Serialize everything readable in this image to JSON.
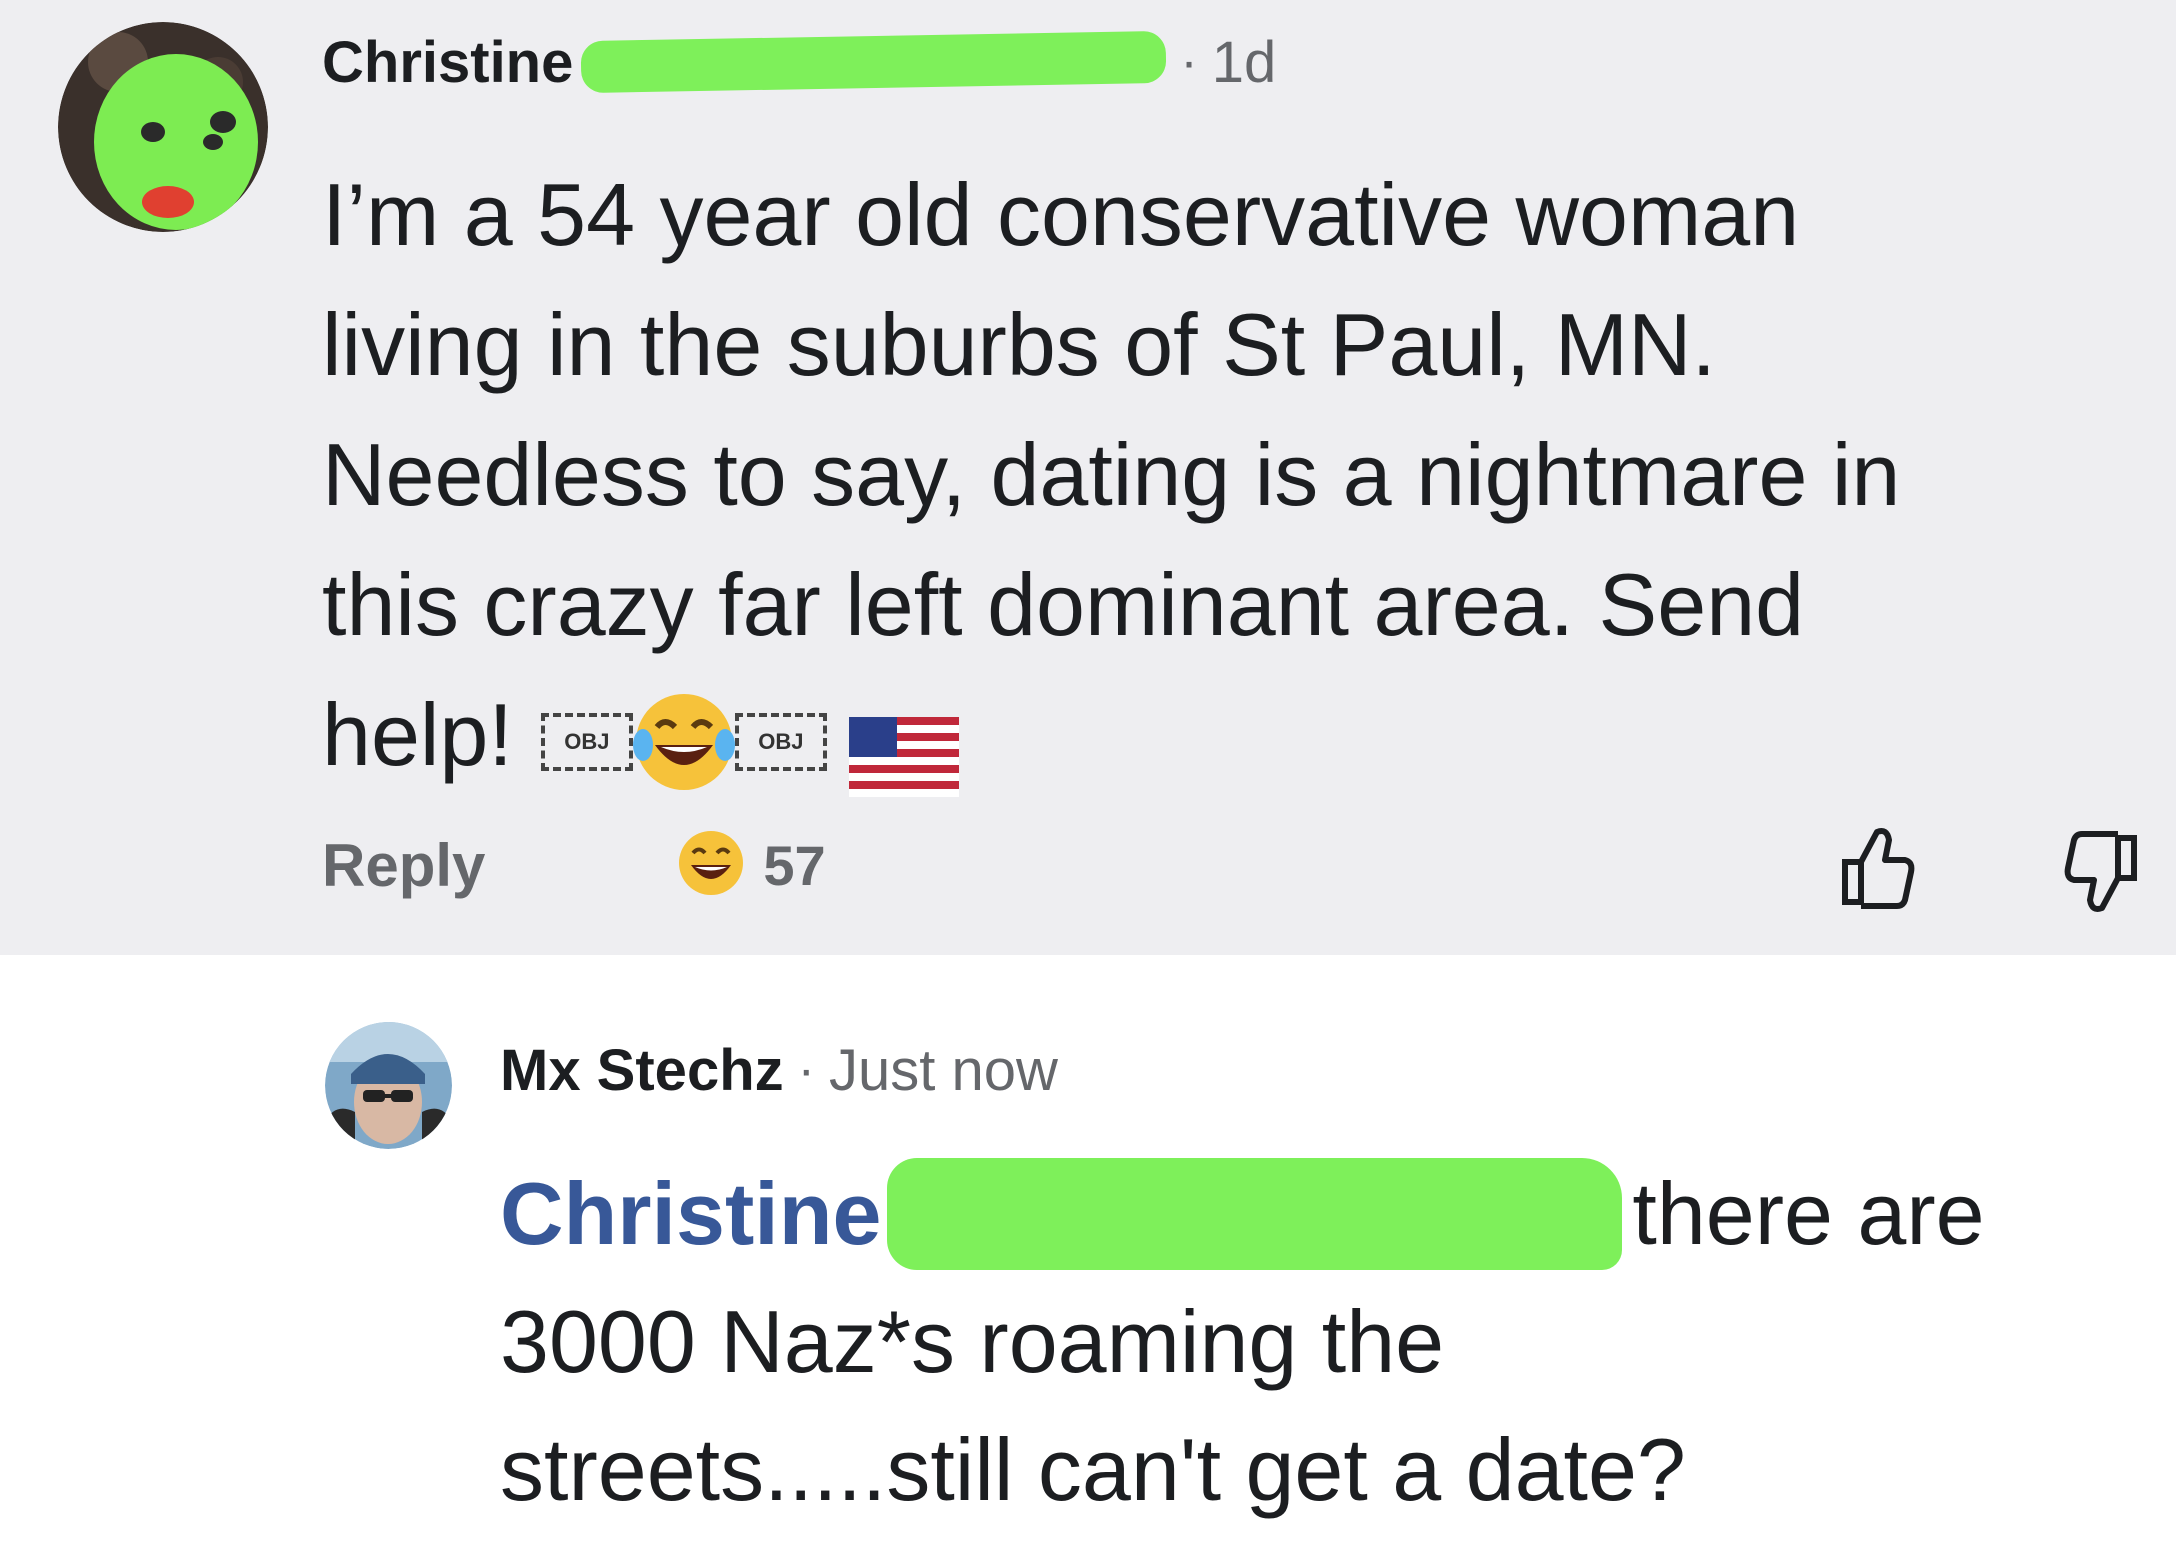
{
  "comments": [
    {
      "author": "Christine",
      "separator": "·",
      "time": "1d",
      "text_lines": [
        "I’m a 54 year old conservative woman",
        "living in the suburbs of St Paul, MN.",
        "Needless to say, dating is a nightmare in",
        "this crazy far left dominant area.  Send",
        "help!"
      ],
      "inline_glyphs": [
        "OBJ",
        "OBJ"
      ],
      "reply_label": "Reply",
      "reaction_count": "57",
      "icons": [
        "laughing-face-icon",
        "us-flag-icon",
        "thumbs-up-icon",
        "thumbs-down-icon",
        "grinning-face-icon"
      ],
      "colors": {
        "background": "#eeeef1",
        "redaction": "#7ef05a"
      }
    },
    {
      "author": "Mx Stechz",
      "separator": "·",
      "time": "Just now",
      "mention": "Christine",
      "text_first_line_rest": "there are",
      "text_lines": [
        "3000 Naz*s roaming the",
        "streets.....still can't get a date?"
      ],
      "colors": {
        "mention": "#385898",
        "background": "#ffffff"
      }
    }
  ]
}
